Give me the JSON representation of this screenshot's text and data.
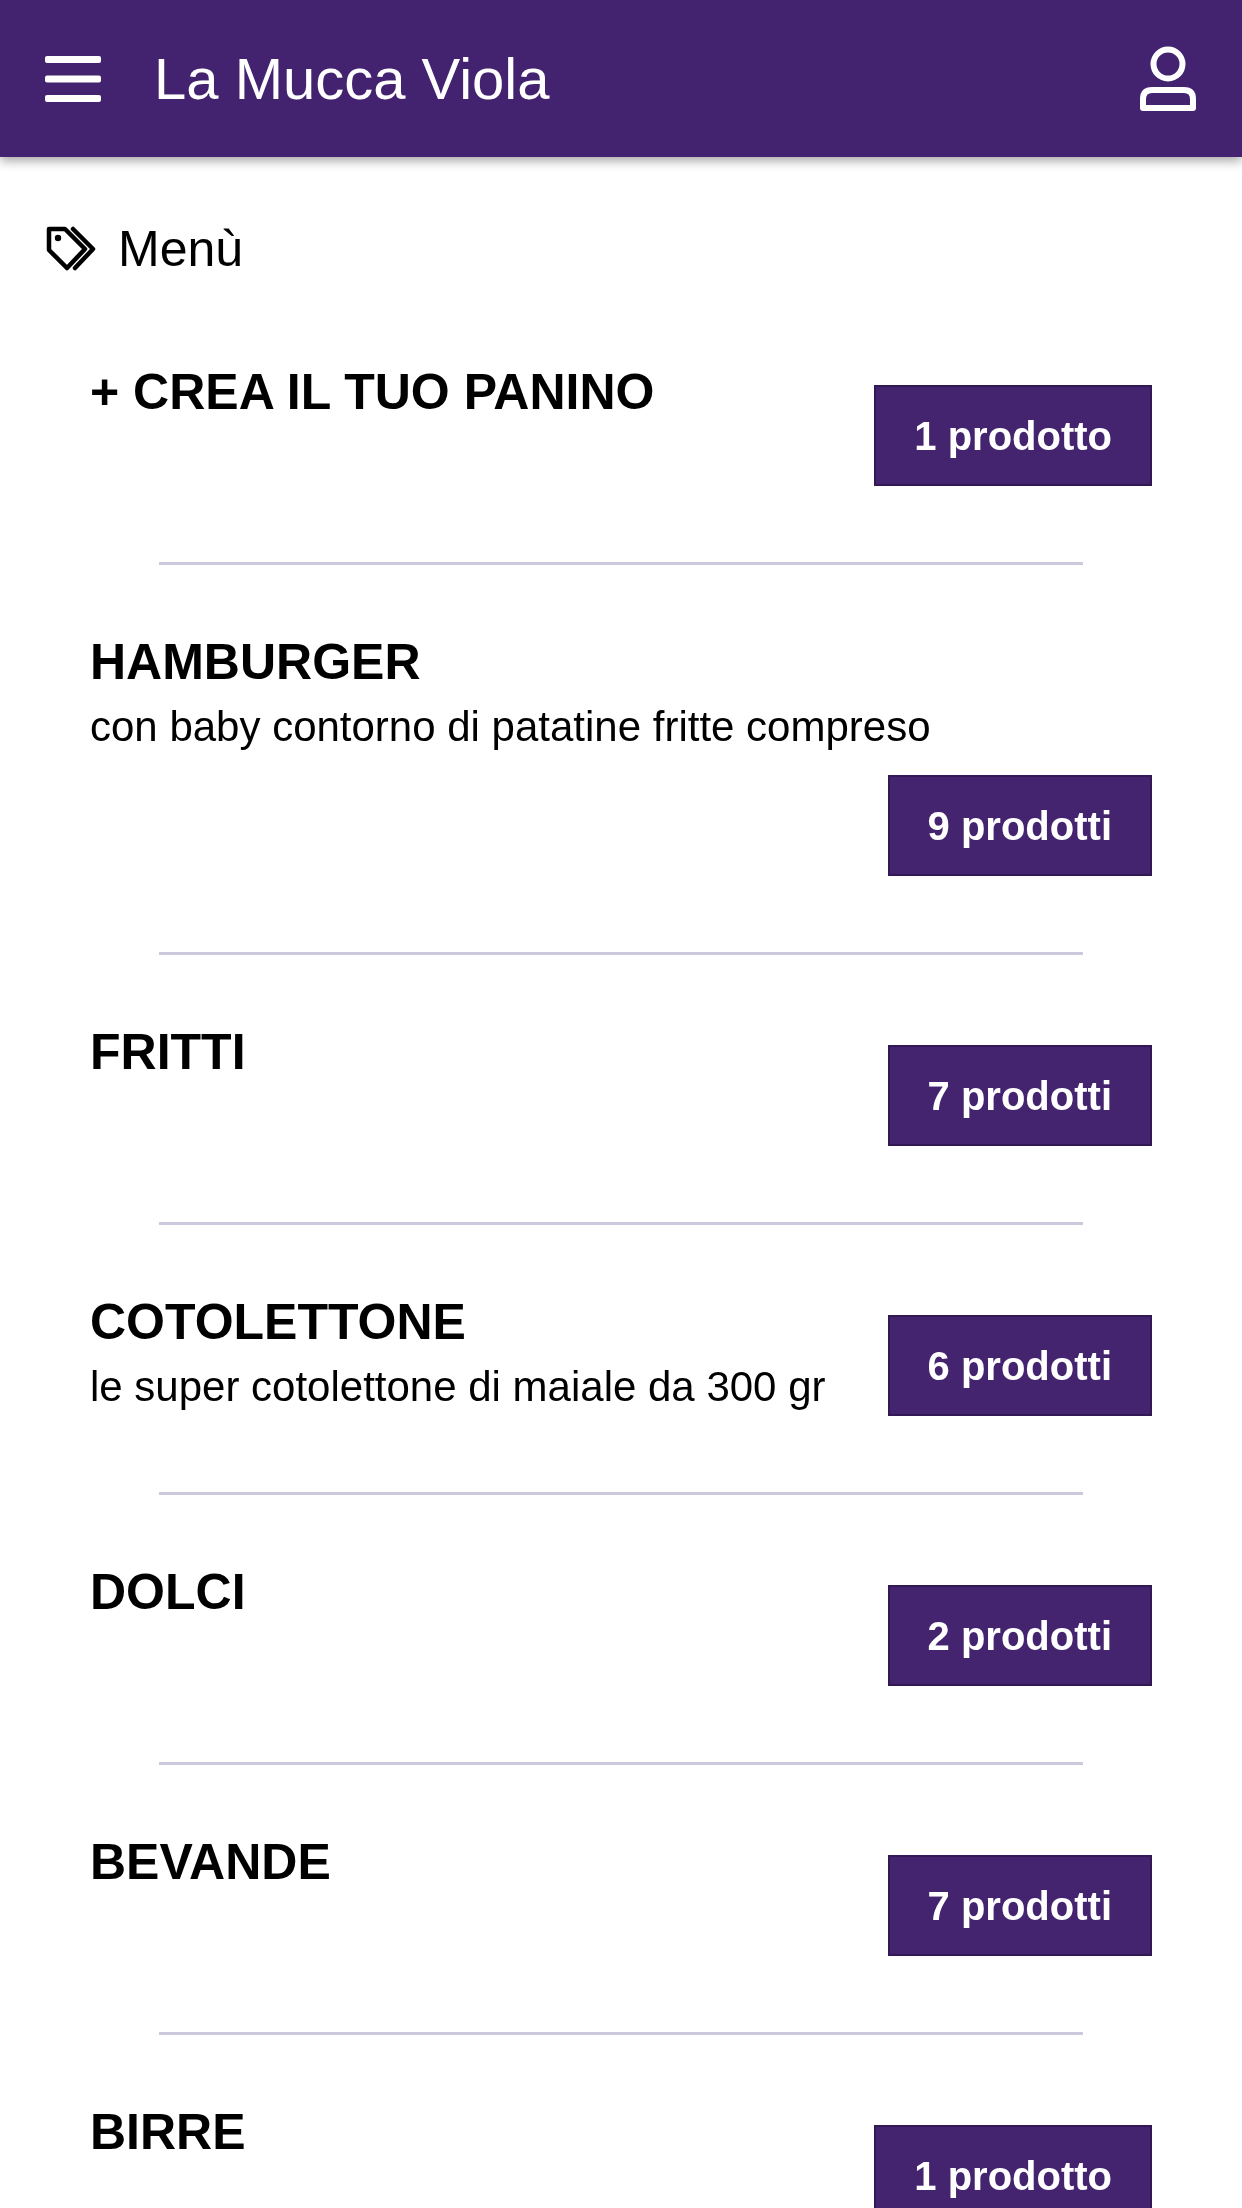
{
  "header": {
    "title": "La Mucca Viola"
  },
  "section": {
    "title": "Menù"
  },
  "categories": [
    {
      "name": "+ CREA IL TUO PANINO",
      "count": "1 prodotto"
    },
    {
      "name": "HAMBURGER",
      "description": "con baby contorno di patatine fritte compreso",
      "count": "9 prodotti"
    },
    {
      "name": "FRITTI",
      "count": "7 prodotti"
    },
    {
      "name": "COTOLETTONE",
      "description": "le super cotolettone di maiale da 300 gr",
      "count": "6 prodotti"
    },
    {
      "name": "DOLCI",
      "count": "2 prodotti"
    },
    {
      "name": "BEVANDE",
      "count": "7 prodotti"
    },
    {
      "name": "BIRRE",
      "count": "1 prodotto"
    }
  ]
}
